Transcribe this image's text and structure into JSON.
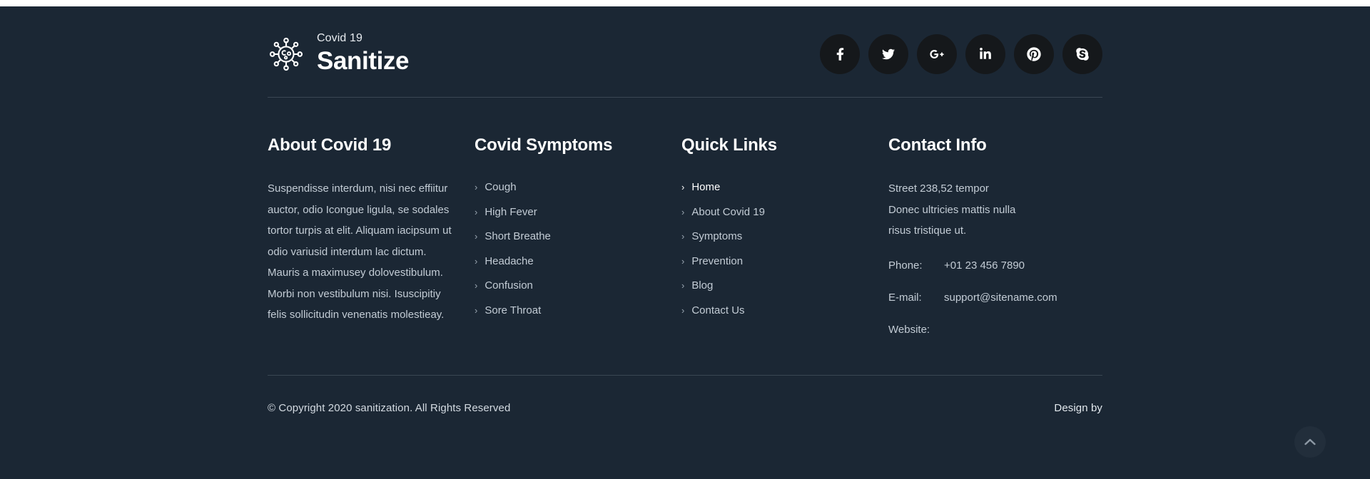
{
  "theme": {
    "background": "#1b2734",
    "social_circle": "#15181b",
    "divider": "#3a4753",
    "text_muted": "#c3ccd5",
    "text_bright": "#ffffff"
  },
  "brand": {
    "sub": "Covid 19",
    "name": "Sanitize",
    "icon": "virus-icon"
  },
  "socials": [
    {
      "name": "facebook",
      "label": "Facebook"
    },
    {
      "name": "twitter",
      "label": "Twitter"
    },
    {
      "name": "google-plus",
      "label": "Google Plus"
    },
    {
      "name": "linkedin",
      "label": "LinkedIn"
    },
    {
      "name": "pinterest",
      "label": "Pinterest"
    },
    {
      "name": "skype",
      "label": "Skype"
    }
  ],
  "columns": {
    "about": {
      "title": "About Covid 19",
      "text": "Suspendisse interdum, nisi nec effiitur auctor, odio Icongue ligula, se sodales tortor turpis at elit. Aliquam iacipsum ut odio variusid interdum lac dictum. Mauris a maximusey dolovestibulum. Morbi non vestibulum nisi. Isuscipitiy felis sollicitudin venenatis molestieay."
    },
    "symptoms": {
      "title": "Covid Symptoms",
      "items": [
        {
          "label": "Cough",
          "active": false
        },
        {
          "label": "High Fever",
          "active": false
        },
        {
          "label": "Short Breathe",
          "active": false
        },
        {
          "label": "Headache",
          "active": false
        },
        {
          "label": "Confusion",
          "active": false
        },
        {
          "label": "Sore Throat",
          "active": false
        }
      ]
    },
    "quick_links": {
      "title": "Quick Links",
      "items": [
        {
          "label": "Home",
          "active": true
        },
        {
          "label": "About Covid 19",
          "active": false
        },
        {
          "label": "Symptoms",
          "active": false
        },
        {
          "label": "Prevention",
          "active": false
        },
        {
          "label": "Blog",
          "active": false
        },
        {
          "label": "Contact Us",
          "active": false
        }
      ]
    },
    "contact": {
      "title": "Contact Info",
      "address_line1": "Street 238,52 tempor",
      "address_line2": "Donec ultricies mattis nulla",
      "address_line3": "risus tristique ut.",
      "phone_label": "Phone:",
      "phone_value": "+01 23 456 7890",
      "email_label": "E-mail:",
      "email_value": "support@sitename.com",
      "website_label": "Website:",
      "website_value": ""
    }
  },
  "bottom": {
    "copyright": "© Copyright 2020 sanitization. All Rights Reserved",
    "design_by": "Design by"
  },
  "scroll_top": {
    "icon": "chevron-up-icon"
  },
  "chevron_glyph": "›"
}
